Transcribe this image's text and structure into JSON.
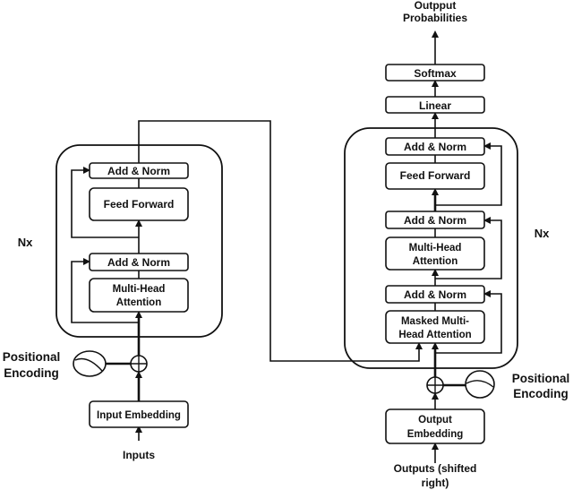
{
  "encoder": {
    "repeat_label": "Nx",
    "add_norm_top": "Add & Norm",
    "feed_forward": "Feed Forward",
    "add_norm_bottom": "Add & Norm",
    "attention": [
      "Multi-Head",
      "Attention"
    ],
    "positional_encoding": [
      "Positional",
      "Encoding"
    ],
    "embedding": "Input Embedding",
    "input_label": "Inputs"
  },
  "decoder": {
    "repeat_label": "Nx",
    "add_norm_top": "Add & Norm",
    "feed_forward": "Feed Forward",
    "add_norm_middle": "Add & Norm",
    "attention": [
      "Multi-Head",
      "Attention"
    ],
    "add_norm_bottom": "Add & Norm",
    "masked_attention": [
      "Masked Multi-",
      "Head Attention"
    ],
    "positional_encoding": [
      "Positional",
      "Encoding"
    ],
    "embedding": [
      "Output",
      "Embedding"
    ],
    "input_label": [
      "Outputs (shifted",
      "right)"
    ]
  },
  "head": {
    "linear": "Linear",
    "softmax": "Softmax",
    "output_label": [
      "Outpput",
      "Probabilities"
    ]
  }
}
